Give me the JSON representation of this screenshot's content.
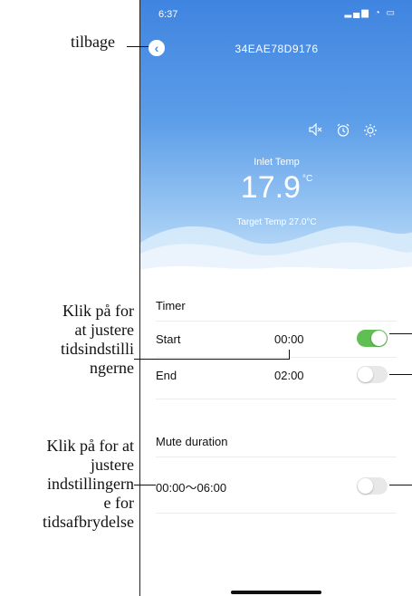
{
  "annotations": {
    "back": "tilbage",
    "timer": "Klik på for at justere tidsindstillingerne",
    "mute": "Klik på for at justere indstillingerne for tidsafbrydelse"
  },
  "status_bar": {
    "time": "6:37",
    "icons": "signal wifi battery"
  },
  "header": {
    "back_icon": "‹",
    "device_id": "34EAE78D9176"
  },
  "toolbar": {
    "icons": [
      "speaker-mute-icon",
      "alarm-clock-icon",
      "sun-icon"
    ]
  },
  "temperature": {
    "inlet_label": "Inlet Temp",
    "inlet_value": "17.9",
    "inlet_unit": "°C",
    "target_label": "Target Temp",
    "target_value": "27.0",
    "target_unit": "°C"
  },
  "timer": {
    "title": "Timer",
    "start_label": "Start",
    "start_value": "00:00",
    "start_enabled": true,
    "end_label": "End",
    "end_value": "02:00",
    "end_enabled": false
  },
  "mute": {
    "title": "Mute duration",
    "range": "00:00～06:00",
    "enabled": false
  },
  "colors": {
    "hero_top": "#3f84e0",
    "toggle_on": "#5fbf53",
    "toggle_off": "#e8e8e8"
  }
}
